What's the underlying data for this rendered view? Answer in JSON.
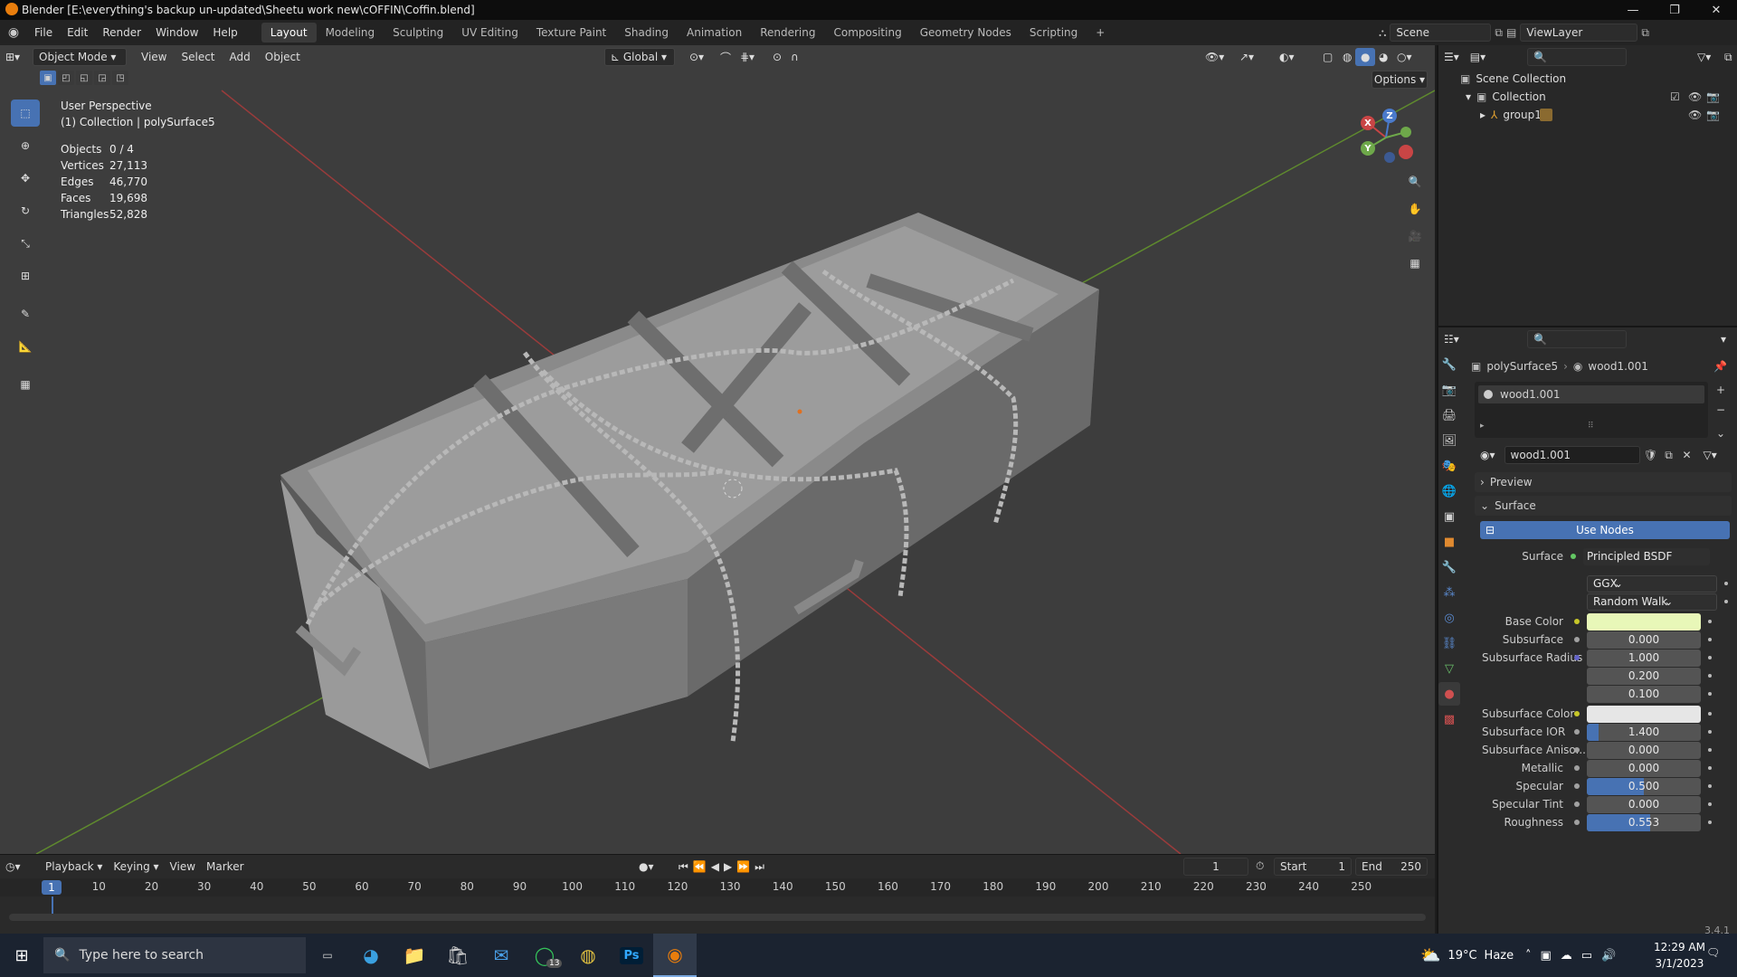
{
  "window": {
    "title": "Blender [E:\\everything's backup un-updated\\Sheetu work new\\cOFFIN\\Coffin.blend]",
    "minimize": "—",
    "maximize": "❐",
    "close": "✕"
  },
  "menus": [
    "File",
    "Edit",
    "Render",
    "Window",
    "Help"
  ],
  "workspaces": [
    "Layout",
    "Modeling",
    "Sculpting",
    "UV Editing",
    "Texture Paint",
    "Shading",
    "Animation",
    "Rendering",
    "Compositing",
    "Geometry Nodes",
    "Scripting"
  ],
  "add_workspace": "+",
  "scene": {
    "name": "Scene"
  },
  "viewlayer": {
    "name": "ViewLayer"
  },
  "viewport": {
    "mode": "Object Mode",
    "menus": [
      "View",
      "Select",
      "Add",
      "Object"
    ],
    "orientation": "Global",
    "options_label": "Options",
    "overlay_title": "User Perspective",
    "overlay_sub": "(1) Collection | polySurface5",
    "stats": [
      {
        "k": "Objects",
        "v": "0 / 4"
      },
      {
        "k": "Vertices",
        "v": "27,113"
      },
      {
        "k": "Edges",
        "v": "46,770"
      },
      {
        "k": "Faces",
        "v": "19,698"
      },
      {
        "k": "Triangles",
        "v": "52,828"
      }
    ],
    "gizmo": {
      "x": "X",
      "y": "Y",
      "z": "Z"
    }
  },
  "timeline": {
    "menus": [
      "Playback",
      "Keying",
      "View",
      "Marker"
    ],
    "current_frame": "1",
    "start_label": "Start",
    "start": "1",
    "end_label": "End",
    "end": "250",
    "ticks": [
      "1",
      "10",
      "20",
      "30",
      "40",
      "50",
      "60",
      "70",
      "80",
      "90",
      "100",
      "110",
      "120",
      "130",
      "140",
      "150",
      "160",
      "170",
      "180",
      "190",
      "200",
      "210",
      "220",
      "230",
      "240",
      "250"
    ]
  },
  "outliner": {
    "scene_collection": "Scene Collection",
    "collection": "Collection",
    "group": "group1"
  },
  "properties": {
    "breadcrumb_object": "polySurface5",
    "breadcrumb_material": "wood1.001",
    "slot": "wood1.001",
    "material_name": "wood1.001",
    "preview_label": "Preview",
    "surface_panel": "Surface",
    "use_nodes": "Use Nodes",
    "surface_label": "Surface",
    "surface_value": "Principled BSDF",
    "distribution": "GGX",
    "subsurface_method": "Random Walk",
    "rows": [
      {
        "label": "Base Color",
        "type": "color",
        "color": "#e8f7b8",
        "sock": "y"
      },
      {
        "label": "Subsurface",
        "value": "0.000",
        "fill": 0,
        "sock": "g0"
      },
      {
        "label": "Subsurface Radius",
        "value": "1.000",
        "fill": 0,
        "sock": "b"
      },
      {
        "label": "",
        "value": "0.200",
        "fill": 0,
        "sock": ""
      },
      {
        "label": "",
        "value": "0.100",
        "fill": 0,
        "sock": ""
      },
      {
        "label": "Subsurface Color",
        "type": "color",
        "color": "#e6e6e6",
        "sock": "y"
      },
      {
        "label": "Subsurface IOR",
        "value": "1.400",
        "fill": 0.1,
        "sock": "g0"
      },
      {
        "label": "Subsurface Aniso...",
        "value": "0.000",
        "fill": 0,
        "sock": "g0"
      },
      {
        "label": "Metallic",
        "value": "0.000",
        "fill": 0,
        "sock": "g0"
      },
      {
        "label": "Specular",
        "value": "0.500",
        "fill": 0.5,
        "sock": "g0"
      },
      {
        "label": "Specular Tint",
        "value": "0.000",
        "fill": 0,
        "sock": "g0"
      },
      {
        "label": "Roughness",
        "value": "0.553",
        "fill": 0.553,
        "sock": "g0"
      }
    ],
    "version": "3.4.1"
  },
  "taskbar": {
    "search_placeholder": "Type here to search",
    "weather_temp": "19°C",
    "weather_desc": "Haze",
    "time": "12:29 AM",
    "date": "3/1/2023",
    "whatsapp_badge": "13",
    "ps_label": "Ps"
  }
}
